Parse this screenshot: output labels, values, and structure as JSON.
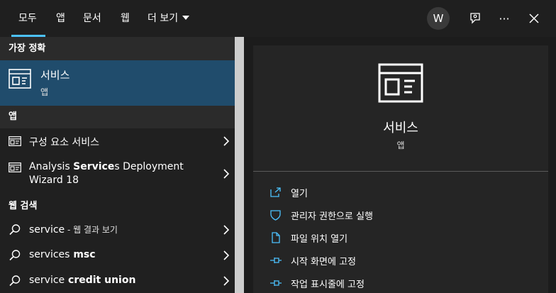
{
  "tabs": [
    {
      "label": "모두"
    },
    {
      "label": "앱"
    },
    {
      "label": "문서"
    },
    {
      "label": "웹"
    },
    {
      "label": "더 보기"
    }
  ],
  "header": {
    "avatar_letter": "W",
    "more_label": "···"
  },
  "best_match": {
    "heading": "가장 정확",
    "title": "서비스",
    "subtitle": "앱"
  },
  "apps": {
    "heading": "앱",
    "items": [
      {
        "label": "구성 요소 서비스"
      },
      {
        "line1_bold_pre": "Analysis ",
        "line1_bold": "Service",
        "line1_rest": "s Deployment",
        "line2": "Wizard 18"
      }
    ]
  },
  "web": {
    "heading": "웹 검색",
    "items": [
      {
        "query": "service",
        "suffix": " - 웹 결과 보기"
      },
      {
        "query": "services",
        "bold": " msc"
      },
      {
        "query": "service",
        "bold": " credit union"
      }
    ]
  },
  "preview": {
    "title": "서비스",
    "subtitle": "앱",
    "actions": [
      {
        "label": "열기"
      },
      {
        "label": "관리자 권한으로 실행"
      },
      {
        "label": "파일 위치 열기"
      },
      {
        "label": "시작 화면에 고정"
      },
      {
        "label": "작업 표시줄에 고정"
      }
    ]
  },
  "colors": {
    "accent": "#4cc2ff",
    "selected_row": "#204c6c",
    "background": "#1c1c1c"
  }
}
